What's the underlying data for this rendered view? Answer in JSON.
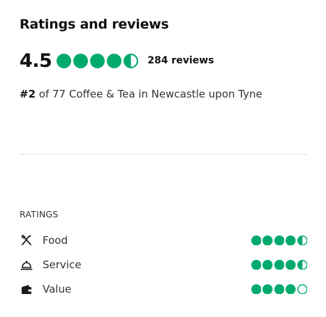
{
  "title": "Ratings and reviews",
  "overall": {
    "score": "4.5",
    "rating": 4.5,
    "review_count": "284 reviews"
  },
  "ranking": {
    "rank": "#2",
    "text": " of 77 Coffee & Tea in Newcastle upon Tyne"
  },
  "ratings_section": {
    "heading": "RATINGS",
    "items": [
      {
        "label": "Food",
        "icon": "utensils-icon",
        "rating": 4.5
      },
      {
        "label": "Service",
        "icon": "cloche-icon",
        "rating": 4.5
      },
      {
        "label": "Value",
        "icon": "wallet-icon",
        "rating": 4.0
      }
    ]
  },
  "colors": {
    "bubble_green": "#00aa6c",
    "text_dark": "#111111",
    "divider": "#e3e3e3"
  }
}
